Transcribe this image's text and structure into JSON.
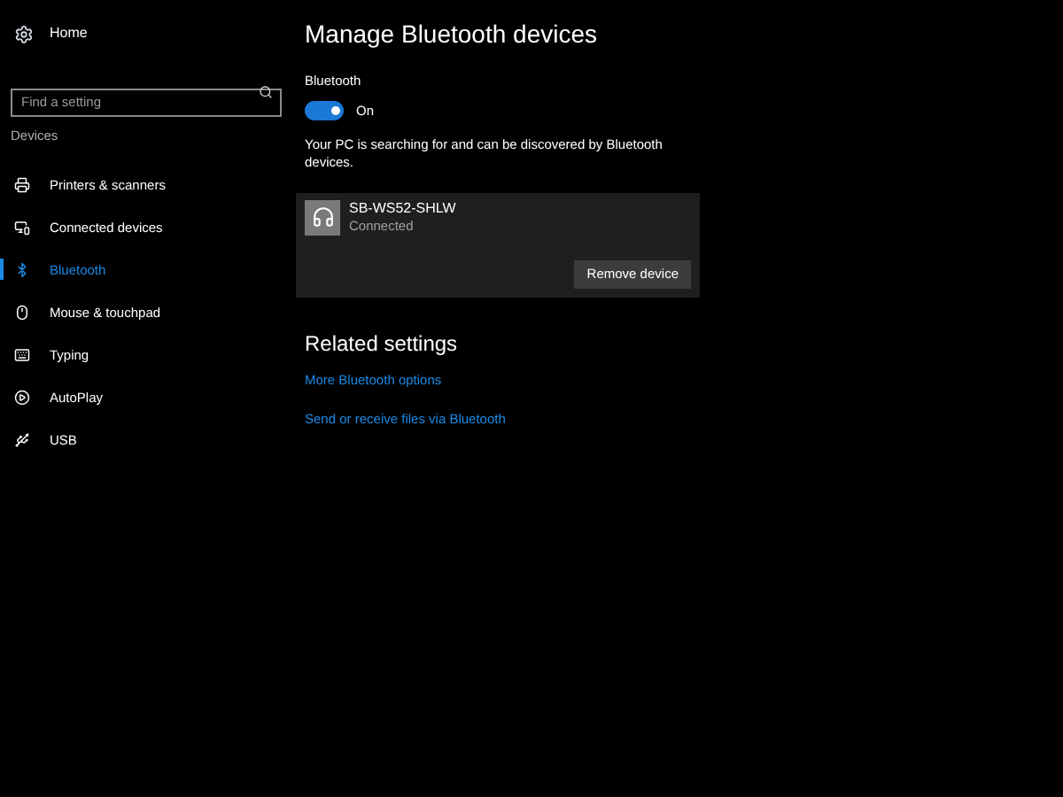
{
  "sidebar": {
    "home": "Home",
    "search": {
      "placeholder": "Find a setting"
    },
    "section": "Devices",
    "items": [
      {
        "label": "Printers & scanners",
        "selected": false
      },
      {
        "label": "Connected devices",
        "selected": false
      },
      {
        "label": "Bluetooth",
        "selected": true
      },
      {
        "label": "Mouse & touchpad",
        "selected": false
      },
      {
        "label": "Typing",
        "selected": false
      },
      {
        "label": "AutoPlay",
        "selected": false
      },
      {
        "label": "USB",
        "selected": false
      }
    ]
  },
  "main": {
    "title": "Manage Bluetooth devices",
    "bluetooth": {
      "label": "Bluetooth",
      "on": true,
      "state_label": "On"
    },
    "status": "Your PC is searching for and can be discovered by Bluetooth devices.",
    "devices": [
      {
        "name": "SB-WS52-SHLW",
        "status": "Connected",
        "button": "Remove device"
      }
    ],
    "related": {
      "title": "Related settings",
      "links": [
        "More Bluetooth options",
        "Send or receive files via Bluetooth"
      ]
    }
  }
}
